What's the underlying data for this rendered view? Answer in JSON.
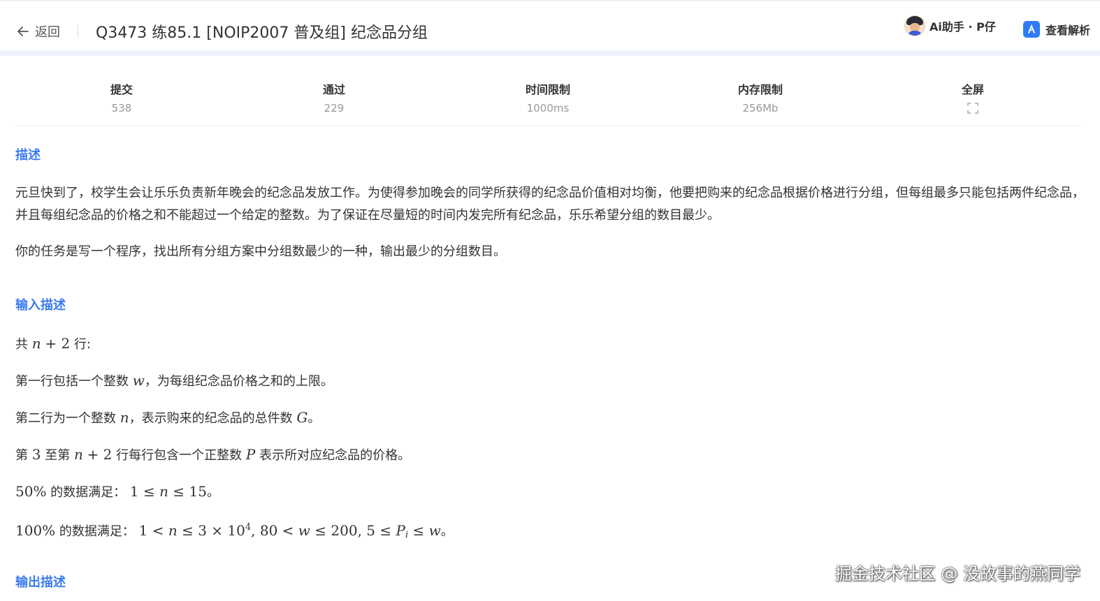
{
  "header": {
    "back_label": "返回",
    "title": "Q3473 练85.1 [NOIP2007 普及组] 纪念品分组",
    "ai_label": "Ai助手 · P仔",
    "analysis_label": "查看解析"
  },
  "stats": [
    {
      "label": "提交",
      "value": "538"
    },
    {
      "label": "通过",
      "value": "229"
    },
    {
      "label": "时间限制",
      "value": "1000ms"
    },
    {
      "label": "内存限制",
      "value": "256Mb"
    },
    {
      "label": "全屏"
    }
  ],
  "sections": {
    "description_title": "描述",
    "description_p1": "元旦快到了，校学生会让乐乐负责新年晚会的纪念品发放工作。为使得参加晚会的同学所获得的纪念品价值相对均衡，他要把购来的纪念品根据价格进行分组，但每组最多只能包括两件纪念品，并且每组纪念品的价格之和不能超过一个给定的整数。为了保证在尽量短的时间内发完所有纪念品，乐乐希望分组的数目最少。",
    "description_p2": "你的任务是写一个程序，找出所有分组方案中分组数最少的一种，输出最少的分组数目。",
    "input_title": "输入描述",
    "input_l1_a": "共",
    "input_l1_b": "行:",
    "input_l2_a": "第一行包括一个整数",
    "input_l2_b": "，为每组纪念品价格之和的上限。",
    "input_l3_a": "第二行为一个整数",
    "input_l3_b": "，表示购来的纪念品的总件数",
    "input_l3_c": "。",
    "input_l4_a": "第",
    "input_l4_b": "至第",
    "input_l4_c": "行每行包含一个正整数",
    "input_l4_d": "表示所对应纪念品的价格。",
    "input_l5_a": "的数据满足：",
    "input_l5_b": "。",
    "input_l6_a": "的数据满足：",
    "input_l6_b": "。",
    "output_title": "输出描述"
  },
  "watermark": "掘金技术社区 @ 没故事的燕同学",
  "colors": {
    "accent": "#3a7bf0",
    "analysis_icon": "#2f7bf5",
    "muted": "#999999"
  }
}
